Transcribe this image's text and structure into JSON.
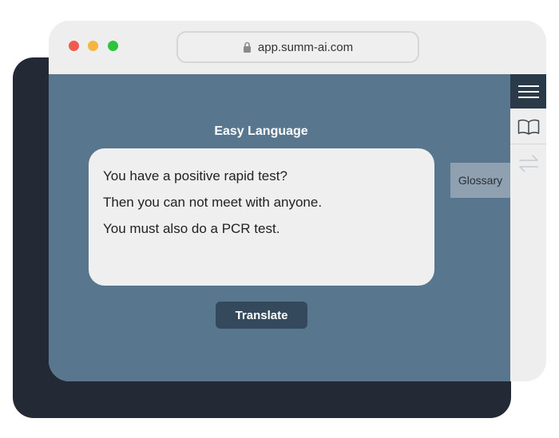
{
  "browser": {
    "url": "app.summ-ai.com",
    "dots": {
      "close": "#f05a50",
      "minimize": "#f4b73e",
      "maximize": "#2cc43d"
    }
  },
  "main": {
    "section_title": "Easy Language",
    "lines": [
      "You have a positive rapid test?",
      "Then you can not meet with anyone.",
      "You must also do a PCR test."
    ],
    "translate_label": "Translate"
  },
  "sidebar": {
    "glossary_label": "Glossary",
    "icons": [
      "menu-icon",
      "book-icon",
      "swap-arrows-icon"
    ]
  },
  "colors": {
    "content_bg": "#58778f",
    "button_bg": "#344a5c",
    "shadow_card": "#242a35"
  }
}
